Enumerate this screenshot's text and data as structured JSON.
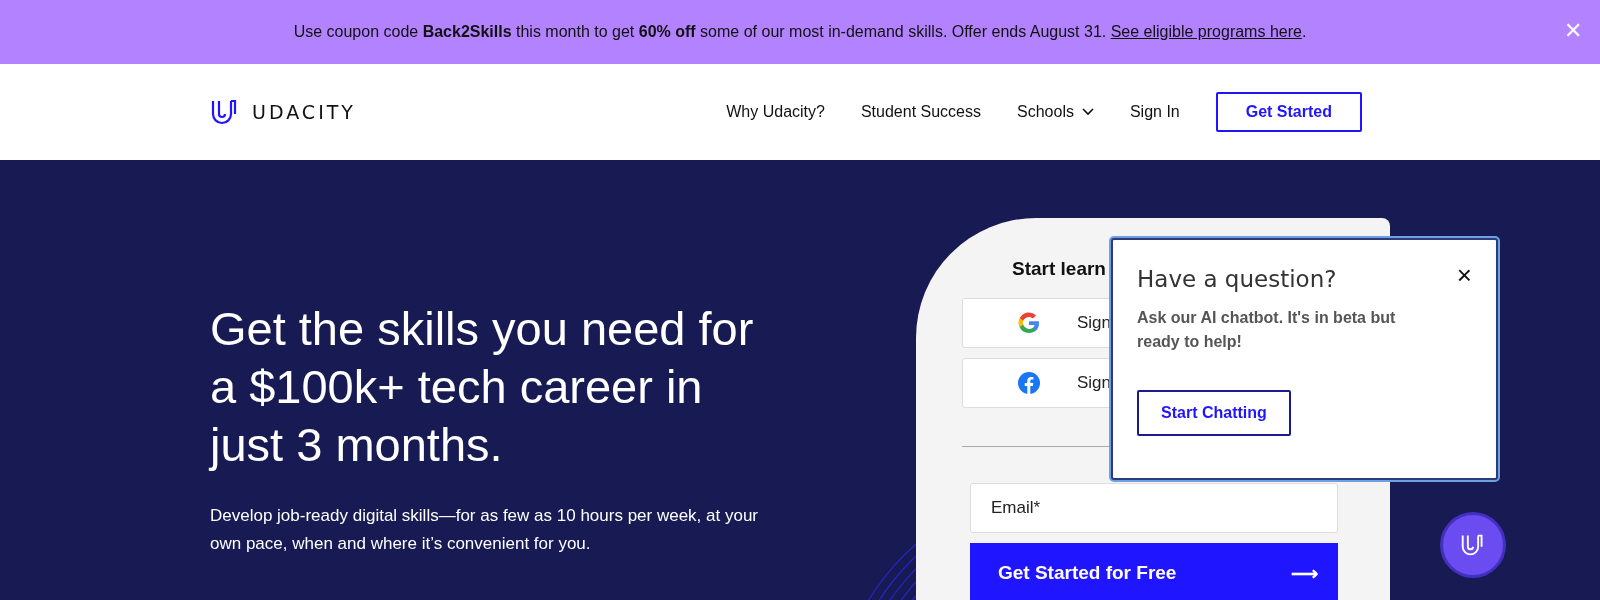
{
  "banner": {
    "text": "Use coupon code **Back2Skills** this month to get **60% off** some of our most in-demand skills. Offer ends August 31. ",
    "link": "See eligible programs here",
    "suffix": ".",
    "close": "✕"
  },
  "nav": {
    "logo": "UDACITY",
    "items": [
      {
        "label": "Why Udacity?",
        "dropdown": false
      },
      {
        "label": "Student Success",
        "dropdown": false
      },
      {
        "label": "Schools",
        "dropdown": true
      },
      {
        "label": "Sign In",
        "dropdown": false
      }
    ],
    "cta": "Get Started"
  },
  "hero": {
    "heading": "Get the skills you need for a $100k+ tech career in just 3 months.",
    "subtext": "Develop job-ready digital skills—for as few as 10 hours per week, at your own pace, when and where it’s convenient for you."
  },
  "signup": {
    "title": "Start learn",
    "providers": [
      {
        "kind": "google",
        "label": "Sign"
      },
      {
        "kind": "facebook",
        "label": "Sign"
      }
    ],
    "email": {
      "placeholder": "Email*"
    },
    "submit": "Get Started for Free",
    "submit_arrow": "⟶"
  },
  "chat_popup": {
    "title": "Have a question?",
    "body": "Ask our AI chatbot. It's in beta but ready to help!",
    "button": "Start Chatting",
    "close": "×"
  }
}
